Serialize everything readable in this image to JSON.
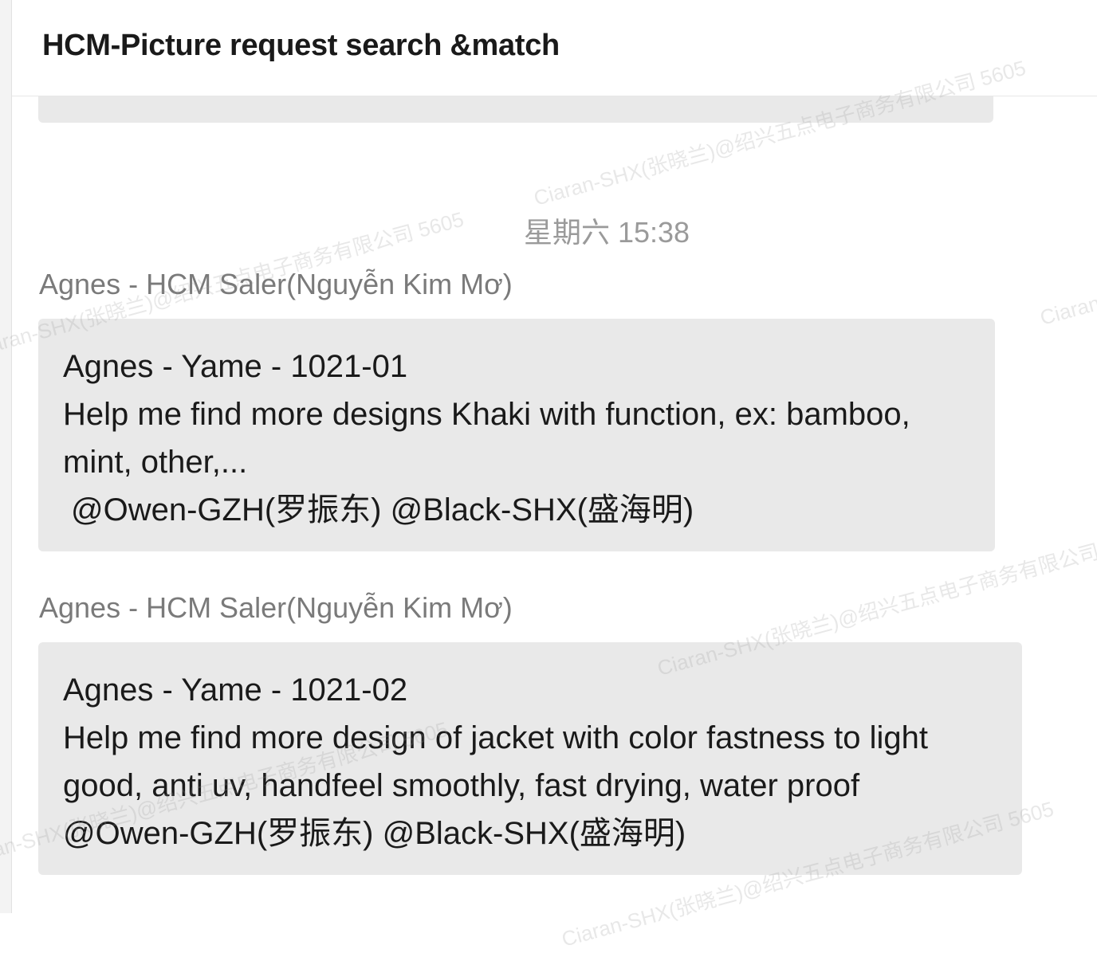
{
  "chat": {
    "title": "HCM-Picture request search &match"
  },
  "timestamp": "星期六 15:38",
  "messages": [
    {
      "sender": "Agnes - HCM Saler(Nguyễn Kim Mơ)",
      "line1": "Agnes - Yame - 1021-01",
      "line2": "Help me find more designs Khaki with function, ex: bamboo,",
      "line3": "mint, other,...",
      "mention1": "@Owen-GZH(罗振东)",
      "mention2": "@Black-SHX(盛海明)"
    },
    {
      "sender": "Agnes - HCM Saler(Nguyễn Kim Mơ)",
      "line1": "Agnes - Yame - 1021-02",
      "line2": "Help me find more design of jacket with color fastness to light",
      "line3": "good, anti uv, handfeel smoothly, fast drying, water proof",
      "mention1": "@Owen-GZH(罗振东)",
      "mention2": "@Black-SHX(盛海明)"
    }
  ],
  "watermark": {
    "text": "Ciaran-SHX(张晓兰)@绍兴五点电子商务有限公司 5605"
  }
}
